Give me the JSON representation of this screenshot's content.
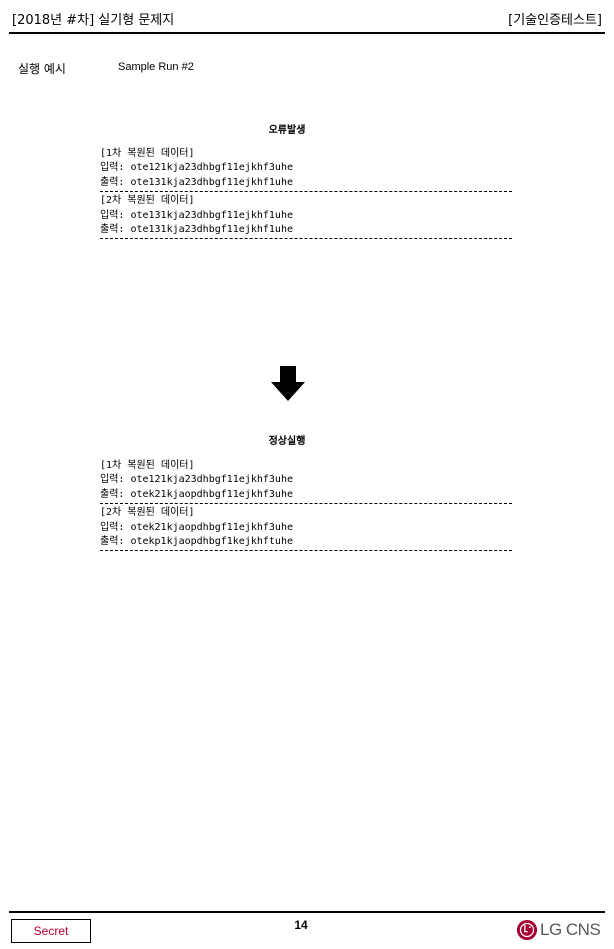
{
  "header": {
    "left_title": "[2018년 #차] 실기형 문제지",
    "right_title": "[기술인증테스트]"
  },
  "example": {
    "label": "실행 예시",
    "run": "Sample Run #2"
  },
  "error_section": {
    "title": "오류발생",
    "cases": [
      {
        "heading": "[1차 복원된 데이터]",
        "input": "입력: ote121kja23dhbgf11ejkhf3uhe",
        "output": "출력: ote131kja23dhbgf11ejkhf1uhe"
      },
      {
        "heading": "[2차 복원된 데이터]",
        "input": "입력: ote131kja23dhbgf11ejkhf1uhe",
        "output": "출력: ote131kja23dhbgf11ejkhf1uhe"
      }
    ]
  },
  "arrow_icon": "down-arrow-icon",
  "normal_section": {
    "title": "정상실행",
    "cases": [
      {
        "heading": "[1차 복원된 데이터]",
        "input": "입력: ote121kja23dhbgf11ejkhf3uhe",
        "output": "출력: otek21kjaopdhbgf11ejkhf3uhe"
      },
      {
        "heading": "[2차 복원된 데이터]",
        "input": "입력: otek21kjaopdhbgf11ejkhf3uhe",
        "output": "출력: otekp1kjaopdhbgf1kejkhftuhe"
      }
    ]
  },
  "footer": {
    "secret_label": "Secret",
    "page_number": "14",
    "logo_text": "LG CNS",
    "secret_color": "#b4002d",
    "logo_color": "#a50034"
  }
}
